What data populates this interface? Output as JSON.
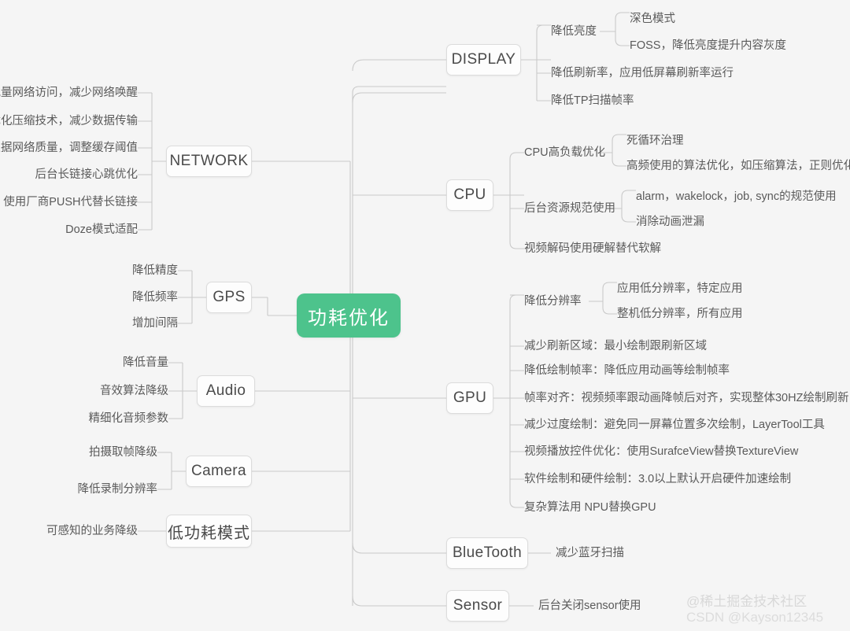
{
  "meta": {
    "background_color": "#f5f5f5",
    "root_color": "#4dc38c",
    "node_border_color": "#dcdcdc",
    "wire_color": "#c9c9c9",
    "text_color": "#5a5a5a"
  },
  "root": {
    "label": "功耗优化"
  },
  "watermark": {
    "line1": "@稀土掘金技术社区",
    "line2": "CSDN @Kayson12345"
  },
  "branches": {
    "display": {
      "label": "DISPLAY",
      "children": [
        {
          "label": "降低亮度",
          "children": [
            {
              "label": "深色模式"
            },
            {
              "label": "FOSS，降低亮度提升内容灰度"
            }
          ]
        },
        {
          "label": "降低刷新率，应用低屏幕刷新率运行"
        },
        {
          "label": "降低TP扫描帧率"
        }
      ]
    },
    "cpu": {
      "label": "CPU",
      "children": [
        {
          "label": "CPU高负载优化",
          "children": [
            {
              "label": "死循环治理"
            },
            {
              "label": "高频使用的算法优化，如压缩算法，正则优化等"
            }
          ]
        },
        {
          "label": "后台资源规范使用",
          "children": [
            {
              "label": "alarm，wakelock，job, sync的规范使用"
            },
            {
              "label": "消除动画泄漏"
            }
          ]
        },
        {
          "label": "视频解码使用硬解替代软解"
        }
      ]
    },
    "gpu": {
      "label": "GPU",
      "children": [
        {
          "label": "降低分辨率",
          "children": [
            {
              "label": "应用低分辨率，特定应用"
            },
            {
              "label": "整机低分辨率，所有应用"
            }
          ]
        },
        {
          "label": "减少刷新区域：最小绘制跟刷新区域"
        },
        {
          "label": "降低绘制帧率：降低应用动画等绘制帧率"
        },
        {
          "label": "帧率对齐：视频频率跟动画降帧后对齐，实现整体30HZ绘制刷新"
        },
        {
          "label": "减少过度绘制：避免同一屏幕位置多次绘制，LayerTool工具"
        },
        {
          "label": "视频播放控件优化：使用SurafceView替换TextureView"
        },
        {
          "label": "软件绘制和硬件绘制：3.0以上默认开启硬件加速绘制"
        },
        {
          "label": "复杂算法用 NPU替换GPU"
        }
      ]
    },
    "bluetooth": {
      "label": "BlueTooth",
      "children": [
        {
          "label": "减少蓝牙扫描"
        }
      ]
    },
    "sensor": {
      "label": "Sensor",
      "children": [
        {
          "label": "后台关闭sensor使用"
        }
      ]
    },
    "network": {
      "label": "NETWORK",
      "children": [
        {
          "label": "批量网络访问，减少网络唤醒"
        },
        {
          "label": "优化压缩技术，减少数据传输"
        },
        {
          "label": "根据网络质量，调整缓存阈值"
        },
        {
          "label": "后台长链接心跳优化"
        },
        {
          "label": "使用厂商PUSH代替长链接"
        },
        {
          "label": "Doze模式适配"
        }
      ]
    },
    "gps": {
      "label": "GPS",
      "children": [
        {
          "label": "降低精度"
        },
        {
          "label": "降低频率"
        },
        {
          "label": "增加间隔"
        }
      ]
    },
    "audio": {
      "label": "Audio",
      "children": [
        {
          "label": "降低音量"
        },
        {
          "label": "音效算法降级"
        },
        {
          "label": "精细化音频参数"
        }
      ]
    },
    "camera": {
      "label": "Camera",
      "children": [
        {
          "label": "拍摄取帧降级"
        },
        {
          "label": "降低录制分辨率"
        }
      ]
    },
    "lowpower": {
      "label": "低功耗模式",
      "children": [
        {
          "label": "可感知的业务降级"
        }
      ]
    }
  }
}
